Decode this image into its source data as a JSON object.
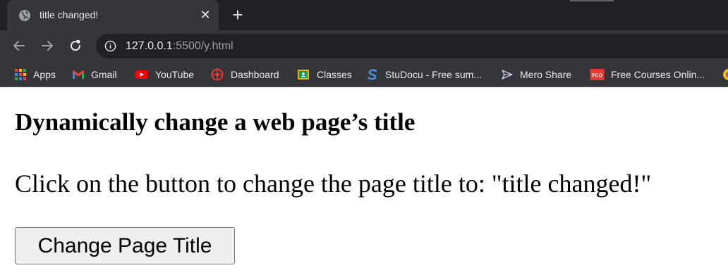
{
  "tab": {
    "title": "title changed!",
    "favicon": "globe-icon",
    "close_label": "✕"
  },
  "new_tab_label": "+",
  "toolbar": {
    "back": "back-arrow-icon",
    "forward": "forward-arrow-icon",
    "reload": "reload-icon",
    "url_host": "127.0.0.1",
    "url_rest": ":5500/y.html"
  },
  "bookmarks": [
    {
      "label": "Apps",
      "icon": "apps-grid-icon"
    },
    {
      "label": "Gmail",
      "icon": "gmail-icon"
    },
    {
      "label": "YouTube",
      "icon": "youtube-icon"
    },
    {
      "label": "Dashboard",
      "icon": "dashboard-icon"
    },
    {
      "label": "Classes",
      "icon": "classroom-icon"
    },
    {
      "label": "StuDocu - Free sum...",
      "icon": "studocu-icon"
    },
    {
      "label": "Mero Share",
      "icon": "mero-share-icon"
    },
    {
      "label": "Free Courses Onlin...",
      "icon": "fco-icon",
      "icon_text": "FCO"
    }
  ],
  "page": {
    "heading": "Dynamically change a web page’s title",
    "paragraph": "Click on the button to change the page title to: \"title changed!\"",
    "button_label": "Change Page Title"
  },
  "colors": {
    "tabstrip": "#202124",
    "toolbar": "#35363a",
    "text_light": "#e8eaed",
    "url_muted": "#9aa0a6",
    "youtube_red": "#ff0000",
    "gmail_red": "#ea4335",
    "fco_red": "#e53935"
  }
}
